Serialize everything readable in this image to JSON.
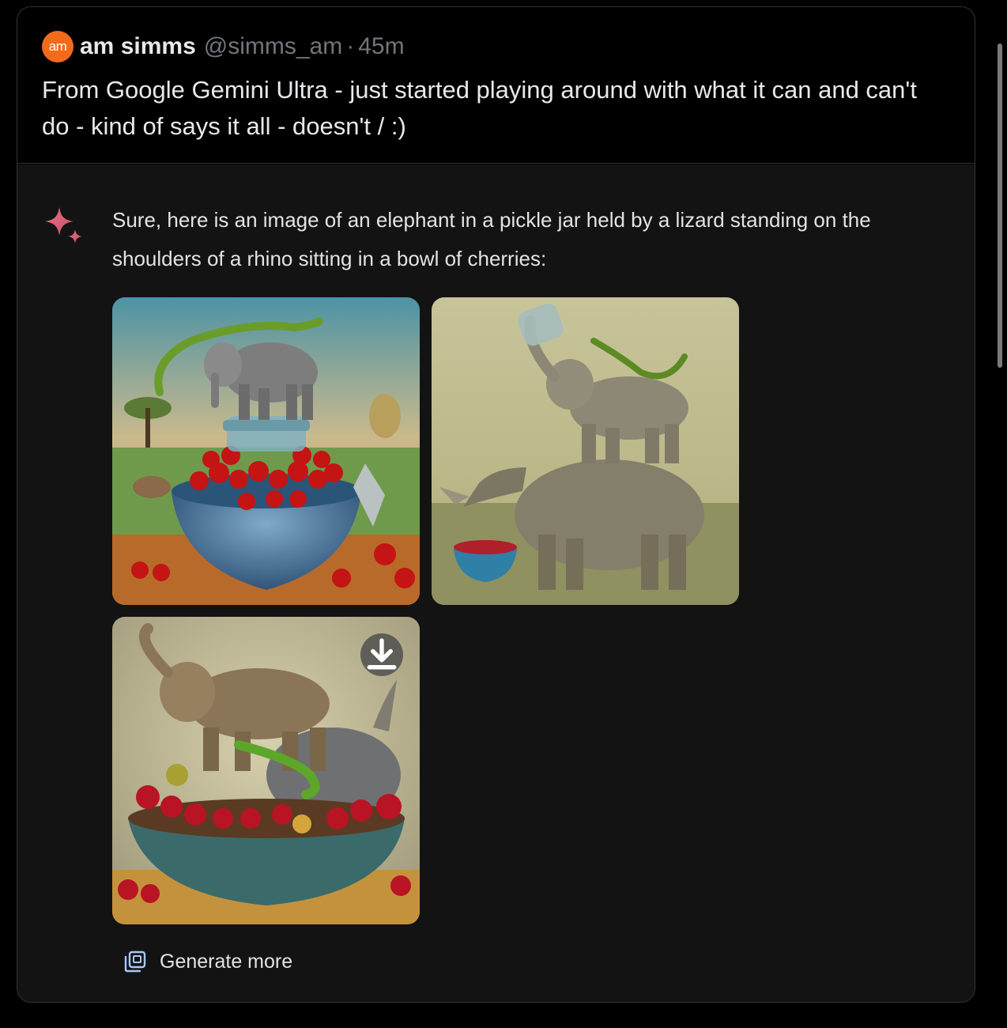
{
  "post": {
    "avatar_text": "am",
    "author_name": "am simms",
    "handle": "@simms_am",
    "separator": "·",
    "time": "45m",
    "text": "From Google Gemini Ultra - just started playing around with what it can and can't do - kind of says it all - doesn't / :)"
  },
  "response": {
    "text": "Sure, here is an image of an elephant in a pickle jar held by a lizard standing on the shoulders of a rhino sitting in a bowl of cherries:",
    "generate_more_label": "Generate more"
  },
  "icons": {
    "sparkle": "gemini-sparkle-icon",
    "download": "download-icon",
    "generate_more": "image-stack-icon"
  },
  "colors": {
    "avatar_bg": "#f26a1b",
    "card_border": "#2f3336",
    "gemini_bg": "#131314",
    "sparkle": "#e0607a"
  }
}
